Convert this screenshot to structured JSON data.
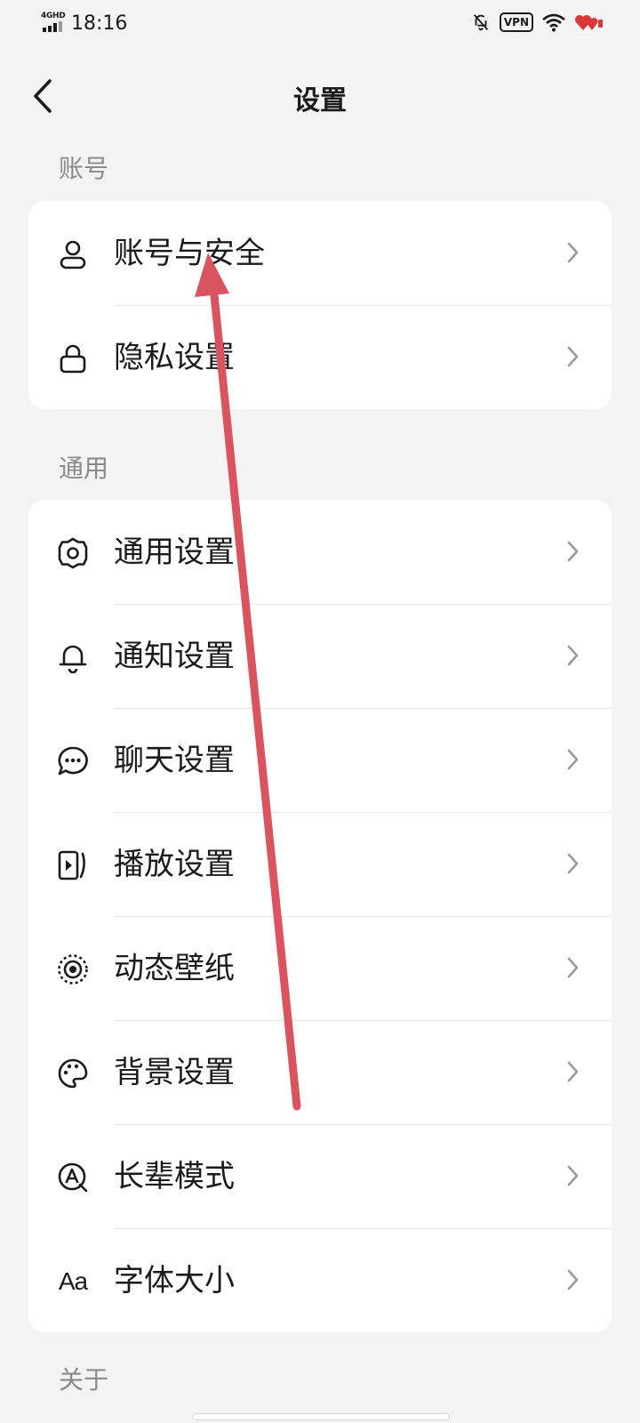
{
  "status_bar": {
    "network": "4GHD",
    "time": "18:16",
    "vpn": "VPN"
  },
  "header": {
    "title": "设置"
  },
  "sections": [
    {
      "label": "账号",
      "items": [
        {
          "label": "账号与安全",
          "icon": "user-icon"
        },
        {
          "label": "隐私设置",
          "icon": "lock-icon"
        }
      ]
    },
    {
      "label": "通用",
      "items": [
        {
          "label": "通用设置",
          "icon": "gear-icon"
        },
        {
          "label": "通知设置",
          "icon": "bell-icon"
        },
        {
          "label": "聊天设置",
          "icon": "chat-bubble-icon"
        },
        {
          "label": "播放设置",
          "icon": "play-icon"
        },
        {
          "label": "动态壁纸",
          "icon": "wallpaper-icon"
        },
        {
          "label": "背景设置",
          "icon": "palette-icon"
        },
        {
          "label": "长辈模式",
          "icon": "elder-mode-icon"
        },
        {
          "label": "字体大小",
          "icon": "font-size-icon",
          "glyph": "Aa"
        }
      ]
    },
    {
      "label": "关于",
      "items": []
    }
  ],
  "colors": {
    "background": "#f3f3f3",
    "card": "#ffffff",
    "section_label": "#8a8a8a",
    "text": "#1b1b1b",
    "annotation_arrow": "#d9545e"
  }
}
